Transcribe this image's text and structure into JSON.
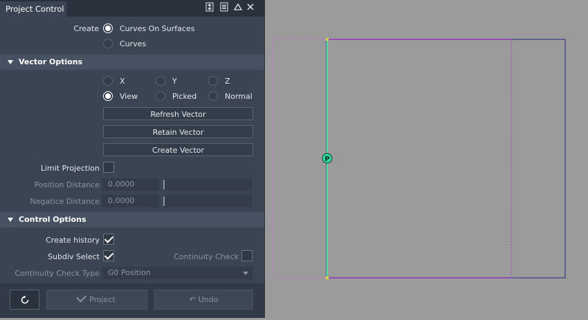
{
  "panel": {
    "title": "Project Control",
    "title_icons": [
      "pin-icon",
      "menu-icon",
      "triangle-icon",
      "close-icon"
    ]
  },
  "create": {
    "label": "Create",
    "options": [
      "Curves On Surfaces",
      "Curves"
    ],
    "selected": "Curves On Surfaces"
  },
  "vector_options": {
    "title": "Vector Options",
    "options": [
      "X",
      "Y",
      "Z",
      "View",
      "Picked",
      "Normal"
    ],
    "selected": "View",
    "refresh_label": "Refresh Vector",
    "retain_label": "Retain Vector",
    "create_label": "Create Vector",
    "limit_projection_label": "Limit Projection",
    "limit_projection_checked": false,
    "position_distance_label": "Position Distance",
    "position_distance_value": "0.0000",
    "negative_distance_label": "Negatice Distance",
    "negative_distance_value": "0.0000"
  },
  "control_options": {
    "title": "Control Options",
    "create_history_label": "Create history",
    "create_history_checked": true,
    "subdiv_select_label": "Subdiv Select",
    "subdiv_select_checked": true,
    "continuity_check_label": "Continuity Check",
    "continuity_check_checked": false,
    "continuity_check_type_label": "Continuity Check Type",
    "continuity_check_type_value": "G0 Position"
  },
  "footer": {
    "reset_icon": "reset-icon",
    "project_label": "Project",
    "undo_label": "Undo"
  },
  "viewport": {
    "marker_label": "P"
  },
  "colors": {
    "panel_bg": "#3a4452",
    "section_bg": "#465161",
    "viewport_bg": "#9b9b9b",
    "curve_green": "#4fe0a0",
    "surface_blue": "#4b4f8a",
    "trim_magenta": "#a040c0"
  }
}
